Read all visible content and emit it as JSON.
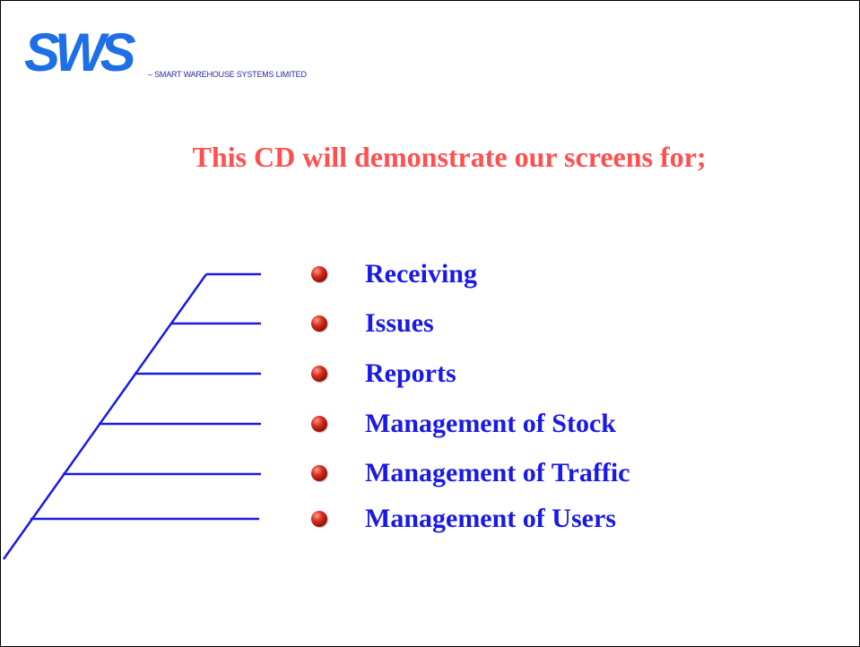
{
  "brand": {
    "logo_text": "SWS",
    "tagline": "– SMART WAREHOUSE SYSTEMS LIMITED",
    "logo_color": "#1e6ee6"
  },
  "heading": "This CD will demonstrate our screens for;",
  "items": [
    {
      "label": "Receiving"
    },
    {
      "label": "Issues"
    },
    {
      "label": "Reports"
    },
    {
      "label": "Management of Stock"
    },
    {
      "label": "Management of Traffic"
    },
    {
      "label": "Management of Users"
    }
  ],
  "colors": {
    "heading": "#ff5050",
    "items": "#1a1ae6",
    "lines": "#1a1ae6",
    "bullet": "#c0281c"
  }
}
